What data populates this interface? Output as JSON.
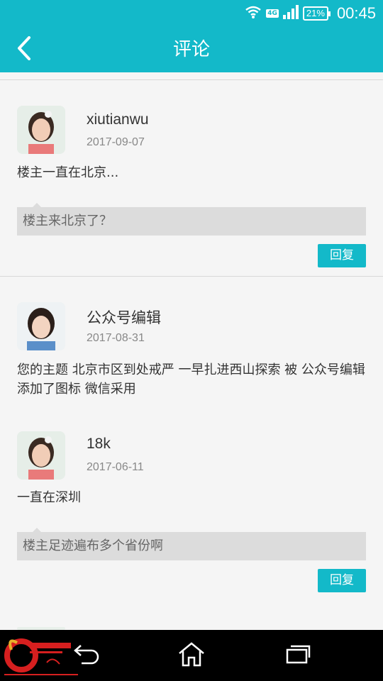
{
  "status_bar": {
    "network": "4G",
    "battery": "21%",
    "time": "00:45"
  },
  "header": {
    "title": "评论"
  },
  "comments": [
    {
      "username": "xiutianwu",
      "date": "2017-09-07",
      "text": "楼主一直在北京...",
      "quote": "楼主来北京了？",
      "reply_label": "回复"
    },
    {
      "username": "公众号编辑",
      "date": "2017-08-31",
      "text": "您的主题 北京市区到处戒严 一早扎进西山探索 被 公众号编辑 添加了图标 微信采用"
    },
    {
      "username": "18k",
      "date": "2017-06-11",
      "text": "一直在深圳",
      "quote": "楼主足迹遍布多个省份啊",
      "reply_label": "回复"
    }
  ],
  "colors": {
    "accent": "#13b9c9",
    "background": "#f5f5f5",
    "quote_bg": "#dcdcdc"
  },
  "icons": {
    "back": "chevron-left-icon",
    "nav_back": "back-arrow-icon",
    "nav_home": "home-icon",
    "nav_recent": "recent-apps-icon"
  }
}
